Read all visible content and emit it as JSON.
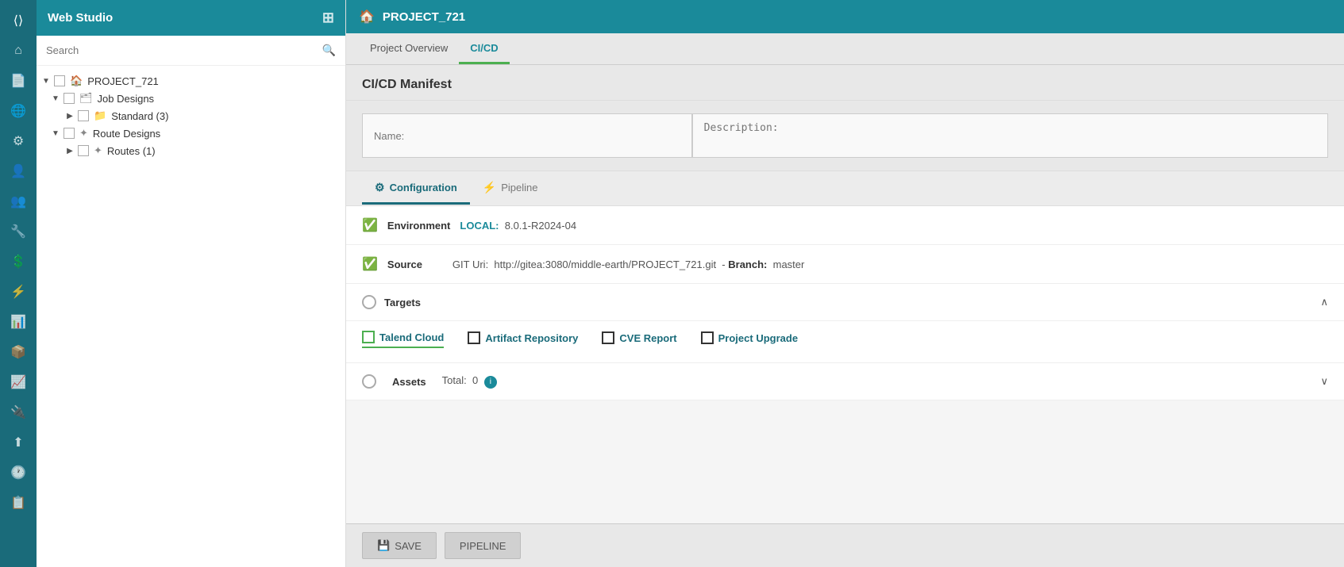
{
  "iconBar": {
    "icons": [
      "⟨⟩",
      "⌂",
      "📄",
      "🌐",
      "⚙",
      "👤",
      "👥",
      "🔧",
      "💲",
      "⚡",
      "📊",
      "📦",
      "📈",
      "🔌",
      "⬆",
      "🕐",
      "📋"
    ]
  },
  "sidebar": {
    "title": "Web Studio",
    "search_placeholder": "Search",
    "tree": [
      {
        "level": 0,
        "arrow": "▼",
        "label": "PROJECT_721",
        "icon": "🏠",
        "hasCheckbox": true
      },
      {
        "level": 1,
        "arrow": "▼",
        "label": "Job Designs",
        "icon": "🗂",
        "hasCheckbox": true
      },
      {
        "level": 2,
        "arrow": "▶",
        "label": "Standard (3)",
        "icon": "📁",
        "hasCheckbox": true
      },
      {
        "level": 1,
        "arrow": "▼",
        "label": "Route Designs",
        "icon": "✦",
        "hasCheckbox": true
      },
      {
        "level": 2,
        "arrow": "▶",
        "label": "Routes (1)",
        "icon": "✦",
        "hasCheckbox": true
      }
    ]
  },
  "header": {
    "project_name": "PROJECT_721"
  },
  "tabs": [
    {
      "label": "Project Overview",
      "active": false
    },
    {
      "label": "CI/CD",
      "active": true
    }
  ],
  "manifest": {
    "title": "CI/CD Manifest",
    "name_placeholder": "Name:",
    "desc_placeholder": "Description:"
  },
  "configTabs": [
    {
      "label": "Configuration",
      "icon": "⚙",
      "active": true
    },
    {
      "label": "Pipeline",
      "icon": "⚡",
      "active": false
    }
  ],
  "environment": {
    "label": "Environment",
    "badge": "LOCAL:",
    "version": "8.0.1-R2024-04"
  },
  "source": {
    "label": "Source",
    "git_label": "GIT Uri:",
    "git_url": "http://gitea:3080/middle-earth/PROJECT_721.git",
    "branch_label": "Branch:",
    "branch_value": "master"
  },
  "targets": {
    "label": "Targets",
    "options": [
      {
        "label": "Talend Cloud",
        "active": true
      },
      {
        "label": "Artifact Repository",
        "active": false
      },
      {
        "label": "CVE Report",
        "active": false
      },
      {
        "label": "Project Upgrade",
        "active": false
      }
    ]
  },
  "assets": {
    "label": "Assets",
    "total_label": "Total:",
    "total_value": "0"
  },
  "actions": {
    "save_label": "SAVE",
    "pipeline_label": "PIPELINE",
    "save_icon": "💾"
  }
}
